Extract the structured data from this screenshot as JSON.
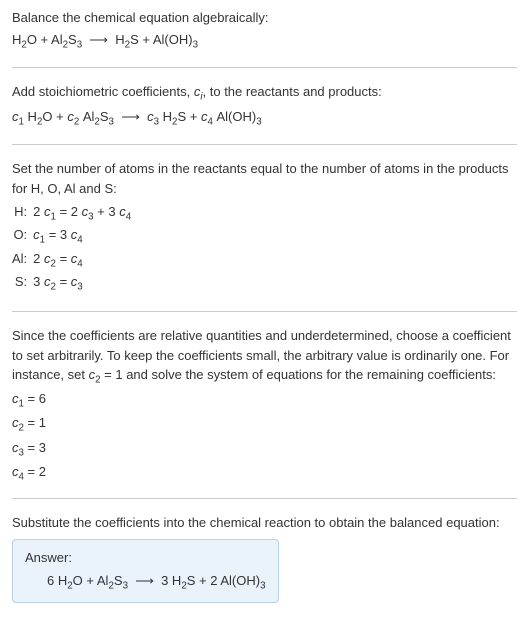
{
  "title": "Balance the chemical equation algebraically:",
  "reaction_plain_html": "H<sub>2</sub>O + Al<sub>2</sub>S<sub>3</sub> &nbsp;⟶&nbsp; H<sub>2</sub>S + Al(OH)<sub>3</sub>",
  "stoich_intro_html": "Add stoichiometric coefficients, <span class='italic'>c<sub>i</sub></span>, to the reactants and products:",
  "stoich_eq_html": "<span class='italic'>c</span><sub>1</sub>&nbsp;H<sub>2</sub>O + <span class='italic'>c</span><sub>2</sub>&nbsp;Al<sub>2</sub>S<sub>3</sub> &nbsp;⟶&nbsp; <span class='italic'>c</span><sub>3</sub>&nbsp;H<sub>2</sub>S + <span class='italic'>c</span><sub>4</sub>&nbsp;Al(OH)<sub>3</sub>",
  "atoms_intro": "Set the number of atoms in the reactants equal to the number of atoms in the products for H, O, Al and S:",
  "element_equations": [
    {
      "label": "H:",
      "eq_html": "2&nbsp;<span class='italic'>c</span><sub>1</sub> = 2&nbsp;<span class='italic'>c</span><sub>3</sub> + 3&nbsp;<span class='italic'>c</span><sub>4</sub>"
    },
    {
      "label": "O:",
      "eq_html": "<span class='italic'>c</span><sub>1</sub> = 3&nbsp;<span class='italic'>c</span><sub>4</sub>"
    },
    {
      "label": "Al:",
      "eq_html": "2&nbsp;<span class='italic'>c</span><sub>2</sub> = <span class='italic'>c</span><sub>4</sub>"
    },
    {
      "label": "S:",
      "eq_html": "3&nbsp;<span class='italic'>c</span><sub>2</sub> = <span class='italic'>c</span><sub>3</sub>"
    }
  ],
  "underdet_text_html": "Since the coefficients are relative quantities and underdetermined, choose a coefficient to set arbitrarily. To keep the coefficients small, the arbitrary value is ordinarily one. For instance, set <span class='italic'>c</span><sub>2</sub> = 1 and solve the system of equations for the remaining coefficients:",
  "solved_coeffs": [
    {
      "html": "<span class='italic'>c</span><sub>1</sub> = 6"
    },
    {
      "html": "<span class='italic'>c</span><sub>2</sub> = 1"
    },
    {
      "html": "<span class='italic'>c</span><sub>3</sub> = 3"
    },
    {
      "html": "<span class='italic'>c</span><sub>4</sub> = 2"
    }
  ],
  "substitute_text": "Substitute the coefficients into the chemical reaction to obtain the balanced equation:",
  "answer_label": "Answer:",
  "answer_eq_html": "6 H<sub>2</sub>O + Al<sub>2</sub>S<sub>3</sub> &nbsp;⟶&nbsp; 3 H<sub>2</sub>S + 2 Al(OH)<sub>3</sub>"
}
